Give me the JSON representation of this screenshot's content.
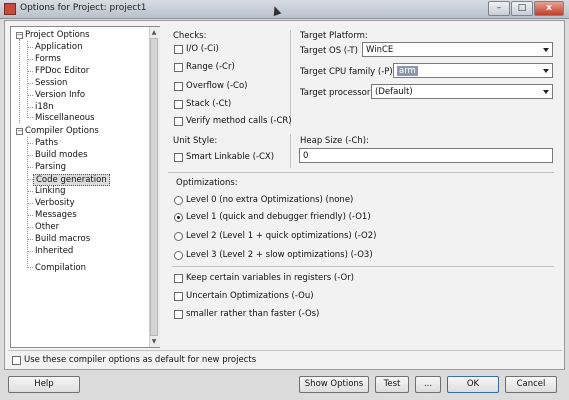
{
  "window": {
    "title": "Options for Project: project1",
    "minimize": "–",
    "maximize": "□",
    "close": "x"
  },
  "tree": {
    "project_options": {
      "label": "Project Options",
      "children": [
        "Application",
        "Forms",
        "FPDoc Editor",
        "Session",
        "Version Info",
        "i18n",
        "Miscellaneous"
      ]
    },
    "compiler_options": {
      "label": "Compiler Options",
      "children": [
        "Paths",
        "Build modes",
        "Parsing",
        "Code generation",
        "Linking",
        "Verbosity",
        "Messages",
        "Other",
        "Build macros",
        "Inherited",
        "Compilation"
      ]
    },
    "selected": "Code generation"
  },
  "checks": {
    "heading": "Checks:",
    "items": [
      {
        "label": "I/O (-Ci)",
        "checked": false
      },
      {
        "label": "Range (-Cr)",
        "checked": false
      },
      {
        "label": "Overflow (-Co)",
        "checked": false
      },
      {
        "label": "Stack (-Ct)",
        "checked": false
      },
      {
        "label": "Verify method calls (-CR)",
        "checked": false
      }
    ]
  },
  "target_platform": {
    "heading": "Target Platform:",
    "os_label": "Target OS (-T)",
    "os_value": "WinCE",
    "cpu_label": "Target CPU family (-P)",
    "cpu_value": "arm",
    "processor_label": "Target processor",
    "processor_value": "(Default)"
  },
  "unit_style": {
    "heading": "Unit Style:",
    "smart_linkable": {
      "label": "Smart Linkable (-CX)",
      "checked": false
    }
  },
  "heap_size": {
    "heading": "Heap Size (-Ch):",
    "value": "0"
  },
  "optimizations": {
    "heading": "Optimizations:",
    "levels": [
      {
        "label": "Level 0 (no extra Optimizations) (none)",
        "selected": false
      },
      {
        "label": "Level 1 (quick and debugger friendly) (-O1)",
        "selected": true
      },
      {
        "label": "Level 2 (Level 1 + quick optimizations) (-O2)",
        "selected": false
      },
      {
        "label": "Level 3 (Level 2 + slow optimizations) (-O3)",
        "selected": false
      }
    ],
    "options": [
      {
        "label": "Keep certain variables in registers (-Or)",
        "checked": false
      },
      {
        "label": "Uncertain Optimizations (-Ou)",
        "checked": false
      },
      {
        "label": "smaller rather than faster (-Os)",
        "checked": false
      }
    ]
  },
  "default_checkbox": {
    "label": "Use these compiler options as default for new projects",
    "checked": false
  },
  "buttons": {
    "help": "Help",
    "show_options": "Show Options",
    "test": "Test",
    "more": "...",
    "ok": "OK",
    "cancel": "Cancel"
  },
  "colors": {
    "title_gradient_top": "#d8dde3",
    "close_button": "#c0402c",
    "selection": "#8a9aae"
  }
}
